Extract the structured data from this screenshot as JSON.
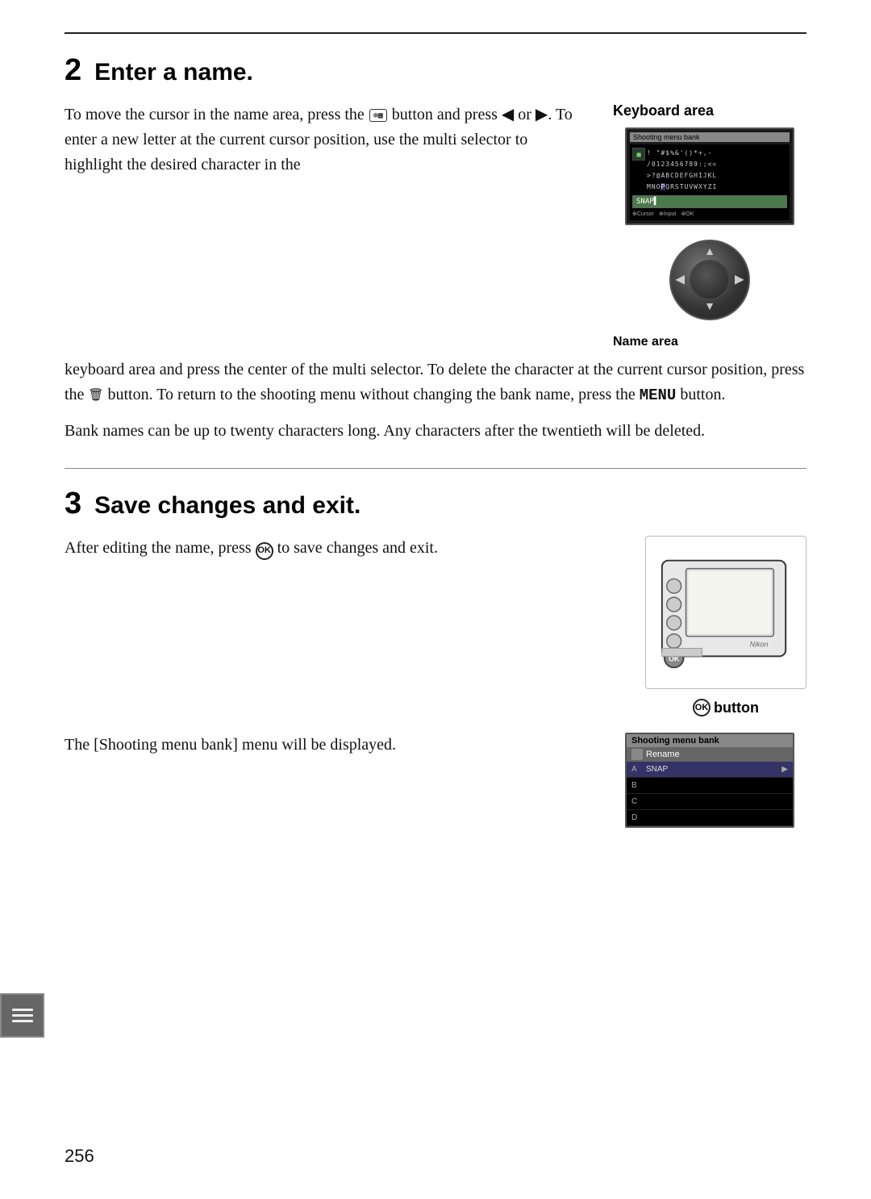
{
  "page": {
    "number": "256"
  },
  "section2": {
    "number": "2",
    "title": "Enter a name.",
    "keyboard_label": "Keyboard area",
    "name_area_label": "Name area",
    "para1": "To move the cursor in the name area, press the",
    "para1b": "button and press ◀ or ▶.  To enter a new letter at the current cursor position, use the multi selector to highlight the desired character in the keyboard area and press the center of the multi selector.  To delete the character at the current cursor position, press the",
    "para1c": "button.  To return to the shooting menu without changing the bank name, press the",
    "menu_bold": "MENU",
    "para1d": "button.",
    "para2": "Bank names can be up to twenty characters long.  Any characters after the twentieth will be deleted."
  },
  "section3": {
    "number": "3",
    "title": "Save changes and exit.",
    "para1": "After editing the name, press",
    "para1b": "to save changes and exit.",
    "ok_button_label": "button",
    "para2": "The [Shooting menu bank] menu will be displayed."
  },
  "keyboard_screen": {
    "title": "Shooting menu bank",
    "row1": "! \"#$%&'()*+,-",
    "row2": "/0123456789:;<=>",
    "row3": ">?@ABCDEFGHIJK L",
    "row4": "MNOPQRSTUVWXYZI",
    "input_value": "SNAP▌",
    "footer": "⊕Cursor  ⊕Input  ⊛OK"
  },
  "menu_screen": {
    "title": "Shooting menu bank",
    "item": "Rename",
    "rows": [
      {
        "label": "A",
        "name": "SNAP",
        "arrow": "▶",
        "highlighted": true
      },
      {
        "label": "B",
        "name": "",
        "arrow": ""
      },
      {
        "label": "C",
        "name": "",
        "arrow": ""
      },
      {
        "label": "D",
        "name": "",
        "arrow": ""
      }
    ]
  }
}
